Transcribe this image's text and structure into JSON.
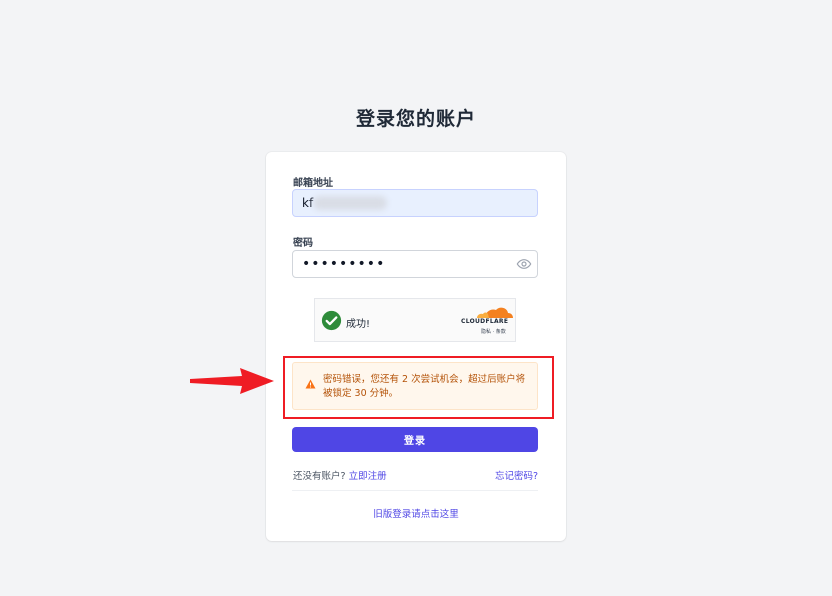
{
  "page": {
    "title": "登录您的账户"
  },
  "form": {
    "email_label": "邮箱地址",
    "email_value": "kf",
    "password_label": "密码",
    "password_value": "123456789",
    "submit_label": "登录"
  },
  "captcha": {
    "status": "成功!",
    "brand": "CLOUDFLARE",
    "links": "隐私 · 条款"
  },
  "alert": {
    "message": "密码错误，您还有 2 次尝试机会，超过后账户将被锁定 30 分钟。"
  },
  "footer": {
    "signup_prompt": "还没有账户?",
    "signup_link": "立即注册",
    "forgot_link": "忘记密码?",
    "legacy_link": "旧版登录请点击这里"
  },
  "colors": {
    "primary": "#4f46e5",
    "warning": "#f97316",
    "success": "#2e8b3a",
    "annotation": "#ef1c24"
  }
}
